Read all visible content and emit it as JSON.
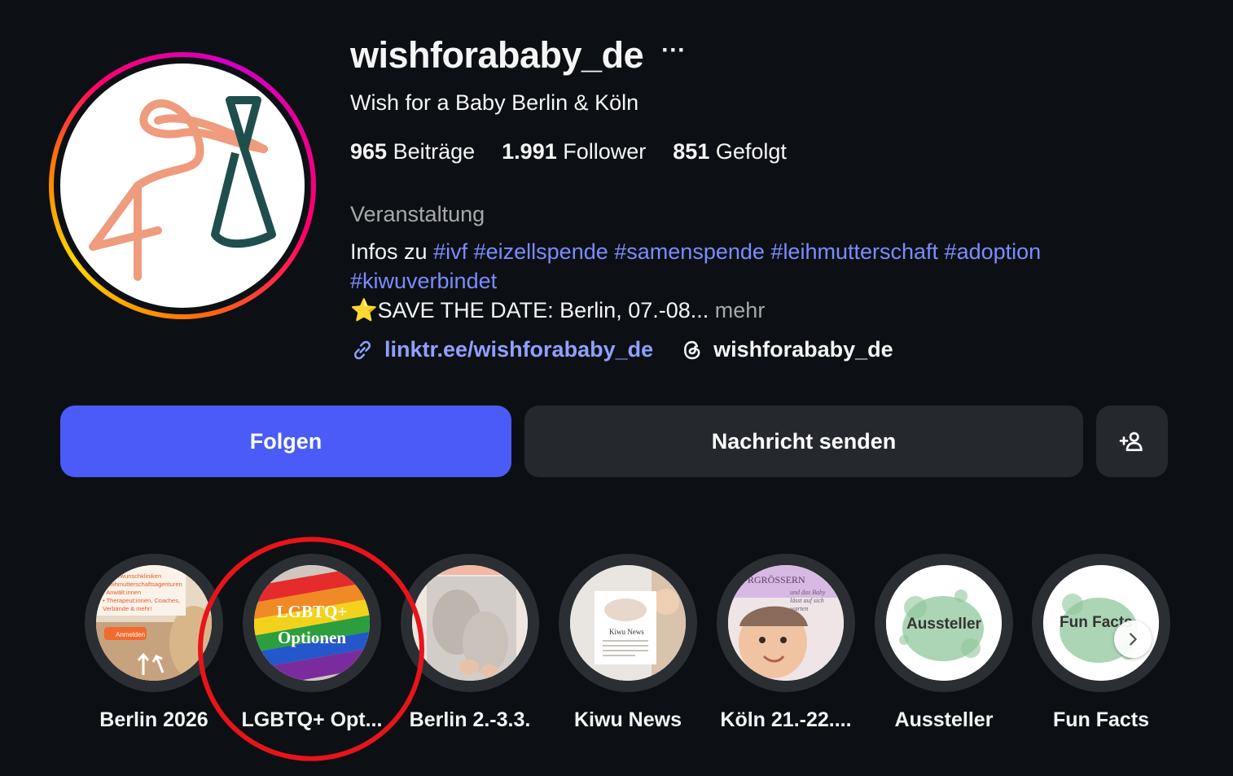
{
  "profile": {
    "username": "wishforababy_de",
    "more_icon": "more-horizontal-icon",
    "full_name": "Wish for a Baby Berlin & Köln",
    "stats": {
      "posts_count": "965",
      "posts_label": "Beiträge",
      "followers_count": "1.991",
      "followers_label": "Follower",
      "following_count": "851",
      "following_label": "Gefolgt"
    },
    "category": "Veranstaltung",
    "bio": {
      "prefix": "Infos zu",
      "hashtags": [
        "#ivf",
        "#eizellspende",
        "#samenspende",
        "#leihmutterschaft",
        "#adoption",
        "#kiwuverbindet"
      ],
      "line3": "⭐SAVE THE DATE: Berlin, 07.-08...",
      "more_label": "mehr"
    },
    "link": {
      "icon": "link-icon",
      "text": "linktr.ee/wishforababy_de"
    },
    "threads": {
      "icon": "threads-icon",
      "text": "wishforababy_de"
    }
  },
  "actions": {
    "follow_label": "Folgen",
    "message_label": "Nachricht senden",
    "add_user_icon": "add-user-icon"
  },
  "highlights": [
    {
      "label": "Berlin 2026",
      "cover_text": [
        "Kinderwunschkliniken",
        "• Leihmutterschaftsagenturen",
        "• Anwält:innen",
        "• Therapeut:innen, Coaches,",
        "Verbände & mehr!"
      ],
      "badge": "Anmelden"
    },
    {
      "label": "LGBTQ+ Opt...",
      "cover_text": [
        "LGBTQ+",
        "Optionen"
      ]
    },
    {
      "label": "Berlin 2.-3.3."
    },
    {
      "label": "Kiwu News",
      "cover_text": [
        "Kiwu News"
      ]
    },
    {
      "label": "Köln 21.-22....",
      "cover_text": [
        "RGRÖSSERN",
        "und das Baby",
        "lässt auf sich",
        "warten"
      ]
    },
    {
      "label": "Aussteller",
      "cover_text": [
        "Aussteller"
      ]
    },
    {
      "label": "Fun Facts",
      "cover_text": [
        "Fun Facts"
      ]
    }
  ],
  "carousel": {
    "next_icon": "chevron-right-icon"
  },
  "annotation": {
    "color": "#e8141a"
  },
  "colors": {
    "follow_button": "#4a5bf7",
    "hashtag": "#7b8cff",
    "background": "#0c1014"
  }
}
